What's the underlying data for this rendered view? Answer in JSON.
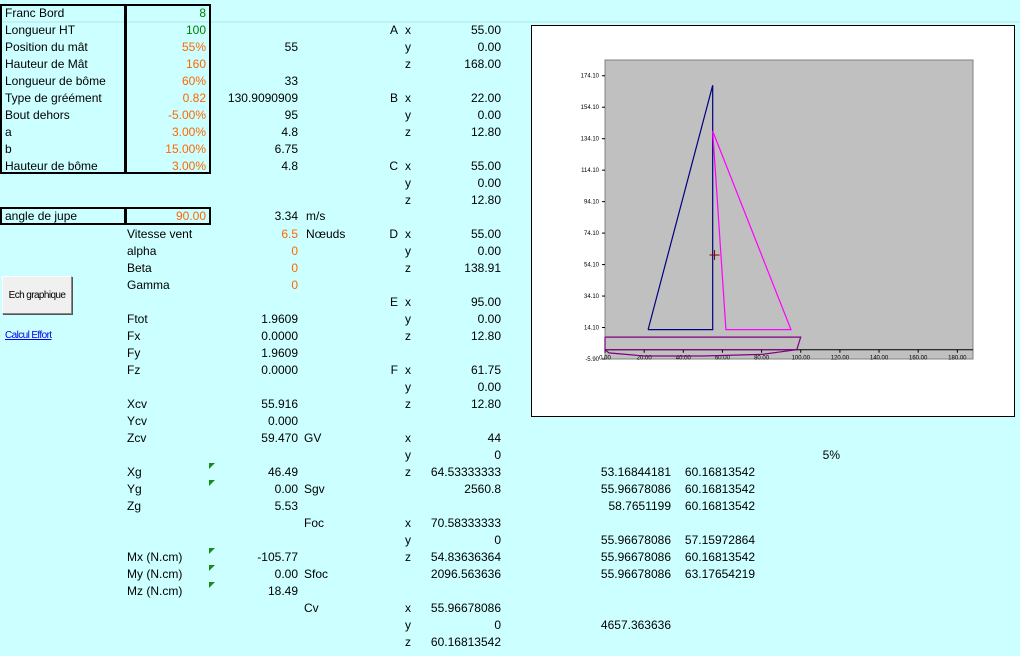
{
  "params": {
    "labels": [
      "Franc Bord",
      "Longueur HT",
      "Position du mât",
      "Hauteur de Mât",
      "Longueur de bôme",
      "Type de gréément",
      "Bout dehors",
      "a",
      "b",
      "Hauteur de bôme"
    ],
    "values": [
      "8",
      "100",
      "55%",
      "160",
      "60%",
      "0.82",
      "-5.00%",
      "3.00%",
      "15.00%",
      "3.00%"
    ],
    "computed": [
      "",
      "",
      "55",
      "",
      "33",
      "130.9090909",
      "95",
      "4.8",
      "6.75",
      "4.8"
    ]
  },
  "jupe": {
    "label": "angle de jupe",
    "value": "90.00",
    "speed": "3.34",
    "unit": "m/s"
  },
  "wind": {
    "labels": [
      "Vitesse vent",
      "alpha",
      "Beta",
      "Gamma"
    ],
    "values": [
      "6.5",
      "0",
      "0",
      "0"
    ],
    "unit": "Nœuds"
  },
  "button": {
    "label": "Ech graphique"
  },
  "link": {
    "label": "Calcul Effort"
  },
  "forces": {
    "labels": [
      "Ftot",
      "Fx",
      "Fy",
      "Fz"
    ],
    "values": [
      "1.9609",
      "0.0000",
      "1.9609",
      "0.0000"
    ]
  },
  "cv": {
    "labels": [
      "Xcv",
      "Ycv",
      "Zcv"
    ],
    "values": [
      "55.916",
      "0.000",
      "59.470"
    ],
    "gv": "GV"
  },
  "g": {
    "labels": [
      "Xg",
      "Yg",
      "Zg"
    ],
    "values": [
      "46.49",
      "0.00",
      "5.53"
    ],
    "sgv": "Sgv",
    "foc": "Foc"
  },
  "moments": {
    "labels": [
      "Mx (N.cm)",
      "My (N.cm)",
      "Mz (N.cm)"
    ],
    "values": [
      "-105.77",
      "0.00",
      "18.49"
    ],
    "sfoc": "Sfoc",
    "cv": "Cv"
  },
  "points": [
    {
      "name": "A",
      "x": "55.00",
      "y": "0.00",
      "z": "168.00"
    },
    {
      "name": "B",
      "x": "22.00",
      "y": "0.00",
      "z": "12.80"
    },
    {
      "name": "C",
      "x": "55.00",
      "y": "0.00",
      "z": "12.80"
    },
    {
      "name": "D",
      "x": "55.00",
      "y": "0.00",
      "z": "138.91"
    },
    {
      "name": "E",
      "x": "95.00",
      "y": "0.00",
      "z": "12.80"
    },
    {
      "name": "F",
      "x": "61.75",
      "y": "0.00",
      "z": "12.80"
    }
  ],
  "gv_vals": {
    "x": "44",
    "y": "0",
    "z": "64.53333333",
    "sgv": "2560.8"
  },
  "foc_vals": {
    "x": "70.58333333",
    "y": "0",
    "z": "54.83636364",
    "sfoc": "2096.563636"
  },
  "cv_vals": {
    "x": "55.96678086",
    "y": "0",
    "z": "60.16813542"
  },
  "axis_letters": [
    "x",
    "y",
    "z"
  ],
  "pct": "5%",
  "extra_col1": [
    "53.16844181",
    "55.96678086",
    "58.7651199",
    "",
    "55.96678086",
    "55.96678086",
    "55.96678086"
  ],
  "extra_col2": [
    "60.16813542",
    "60.16813542",
    "60.16813542",
    "",
    "57.15972864",
    "60.16813542",
    "63.17654219"
  ],
  "extra_total": "4657.363636",
  "chart_data": {
    "type": "scatter",
    "y_ticks": [
      "174.10",
      "154.10",
      "134.10",
      "114.10",
      "94.10",
      "74.10",
      "54.10",
      "34.10",
      "14.10",
      "-5.90"
    ],
    "x_ticks": [
      "0.00",
      "20.00",
      "40.00",
      "60.00",
      "80.00",
      "100.00",
      "120.00",
      "140.00",
      "160.00",
      "180.00"
    ],
    "xlim": [
      0,
      188
    ],
    "ylim": [
      -5.9,
      184.1
    ],
    "series": [
      {
        "color": "#000080",
        "points": [
          [
            22,
            12.8
          ],
          [
            55,
            168
          ],
          [
            55,
            12.8
          ],
          [
            22,
            12.8
          ]
        ]
      },
      {
        "color": "#ff00ff",
        "points": [
          [
            55,
            138.91
          ],
          [
            95,
            12.8
          ],
          [
            61.75,
            12.8
          ],
          [
            55,
            138.91
          ]
        ]
      },
      {
        "color": "#800080",
        "points": [
          [
            0,
            8
          ],
          [
            100,
            8
          ],
          [
            98,
            0
          ],
          [
            0,
            0
          ],
          [
            0,
            8
          ]
        ]
      },
      {
        "color": "#800080",
        "points": [
          [
            0,
            0
          ],
          [
            2,
            -2
          ],
          [
            20,
            -4
          ],
          [
            50,
            -4
          ],
          [
            80,
            -3
          ],
          [
            98,
            0
          ]
        ]
      }
    ],
    "cross": [
      55.97,
      60.17
    ]
  }
}
